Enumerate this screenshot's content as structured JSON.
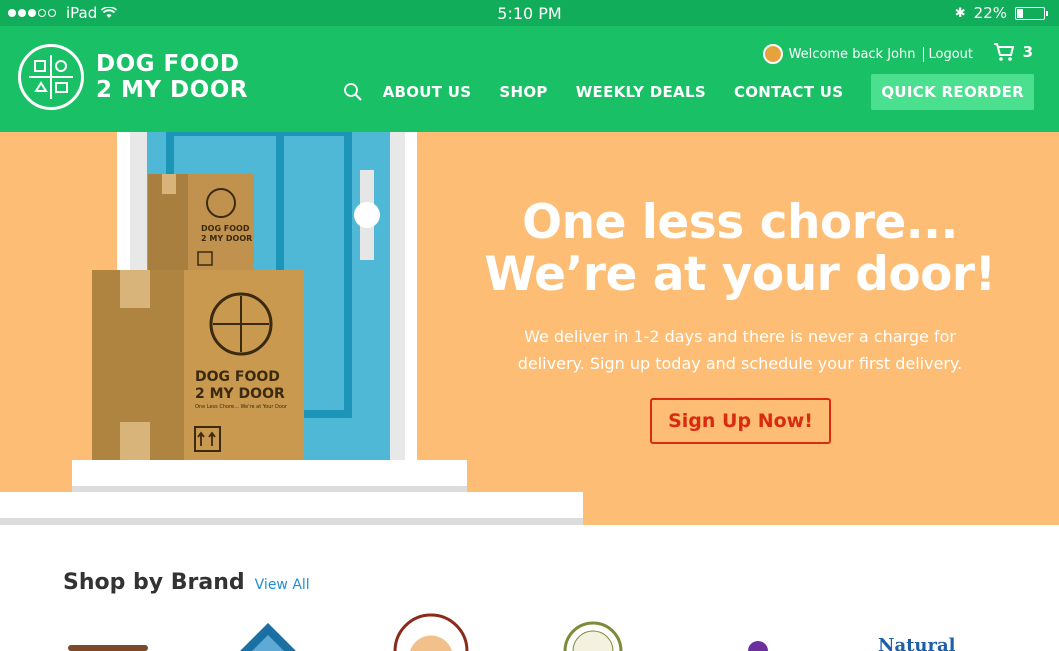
{
  "status_bar": {
    "device": "iPad",
    "time": "5:10 PM",
    "battery": "22%"
  },
  "header": {
    "logo_line1": "DOG FOOD",
    "logo_line2": "2 MY DOOR",
    "welcome": "Welcome back John",
    "logout": "Logout",
    "cart_count": "3",
    "nav": [
      "ABOUT US",
      "SHOP",
      "WEEKLY DEALS",
      "CONTACT US"
    ],
    "quick_reorder": "QUICK REORDER"
  },
  "hero": {
    "title_line1": "One less chore...",
    "title_line2": "We’re at your door!",
    "subtitle": "We deliver in 1-2 days and there is never a charge for delivery. Sign up today and schedule your first delivery.",
    "cta": "Sign Up Now!",
    "box_brand_line1": "DOG FOOD",
    "box_brand_line2": "2 MY DOOR",
    "box_tagline": "One Less Chore... We're at Your Door"
  },
  "brands": {
    "title": "Shop by Brand",
    "view_all": "View All",
    "logo_text": "Natural"
  },
  "colors": {
    "header_green": "#19c065",
    "status_green": "#12ad5a",
    "hero_orange": "#fdbd74",
    "cta_red": "#d92b10",
    "door_blue": "#4fb8d6"
  }
}
